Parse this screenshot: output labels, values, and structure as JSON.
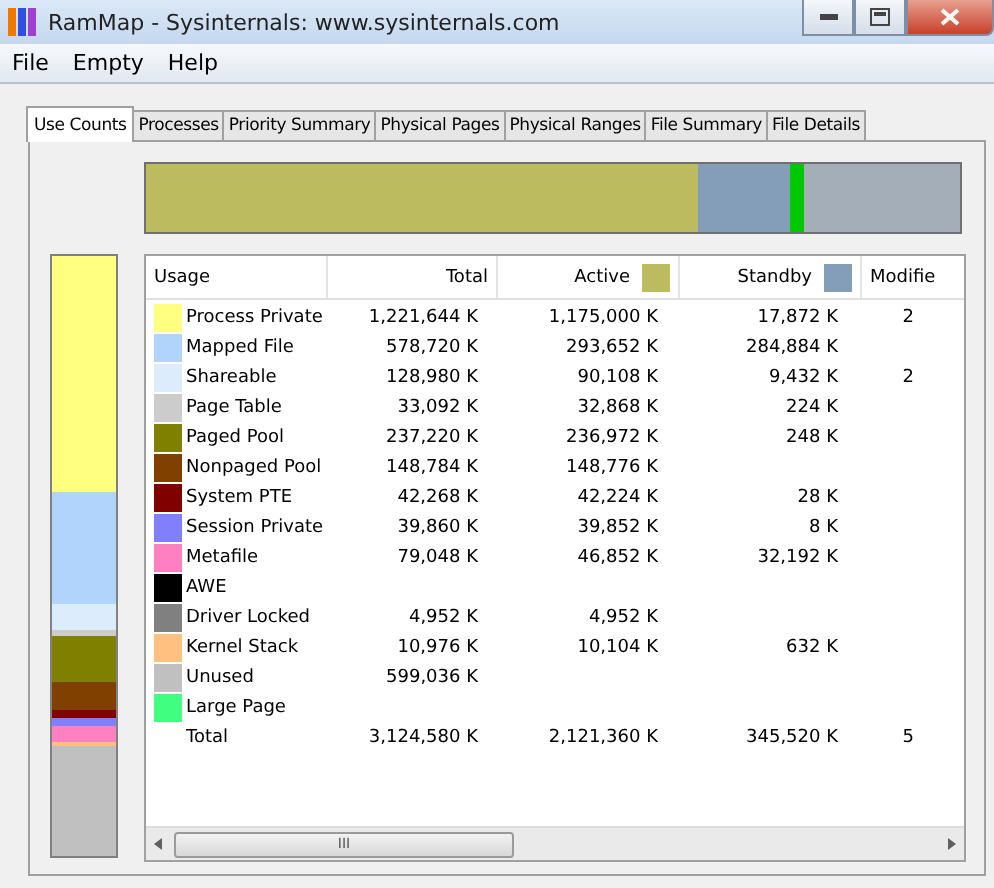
{
  "window": {
    "title": "RamMap - Sysinternals: www.sysinternals.com"
  },
  "menu": [
    "File",
    "Empty",
    "Help"
  ],
  "tabs": [
    {
      "label": "Use Counts",
      "selected": true
    },
    {
      "label": "Processes",
      "selected": false
    },
    {
      "label": "Priority Summary",
      "selected": false
    },
    {
      "label": "Physical Pages",
      "selected": false
    },
    {
      "label": "Physical Ranges",
      "selected": false
    },
    {
      "label": "File Summary",
      "selected": false
    },
    {
      "label": "File Details",
      "selected": false
    }
  ],
  "table": {
    "columns": [
      {
        "label": "Usage"
      },
      {
        "label": "Total"
      },
      {
        "label": "Active",
        "color": "#bdbb5f"
      },
      {
        "label": "Standby",
        "color": "#849eba"
      },
      {
        "label": "Modifie"
      }
    ],
    "rows": [
      {
        "color": "#ffff80",
        "usage": "Process Private",
        "total": "1,221,644 K",
        "active": "1,175,000 K",
        "standby": "17,872 K",
        "modified": "2"
      },
      {
        "color": "#b0d4fc",
        "usage": "Mapped File",
        "total": "578,720 K",
        "active": "293,652 K",
        "standby": "284,884 K",
        "modified": ""
      },
      {
        "color": "#dcecfc",
        "usage": "Shareable",
        "total": "128,980 K",
        "active": "90,108 K",
        "standby": "9,432 K",
        "modified": "2"
      },
      {
        "color": "#cccccc",
        "usage": "Page Table",
        "total": "33,092 K",
        "active": "32,868 K",
        "standby": "224 K",
        "modified": ""
      },
      {
        "color": "#808000",
        "usage": "Paged Pool",
        "total": "237,220 K",
        "active": "236,972 K",
        "standby": "248 K",
        "modified": ""
      },
      {
        "color": "#804000",
        "usage": "Nonpaged Pool",
        "total": "148,784 K",
        "active": "148,776 K",
        "standby": "",
        "modified": ""
      },
      {
        "color": "#800000",
        "usage": "System PTE",
        "total": "42,268 K",
        "active": "42,224 K",
        "standby": "28 K",
        "modified": ""
      },
      {
        "color": "#8080ff",
        "usage": "Session Private",
        "total": "39,860 K",
        "active": "39,852 K",
        "standby": "8 K",
        "modified": ""
      },
      {
        "color": "#ff80c0",
        "usage": "Metafile",
        "total": "79,048 K",
        "active": "46,852 K",
        "standby": "32,192 K",
        "modified": ""
      },
      {
        "color": "#000000",
        "usage": "AWE",
        "total": "",
        "active": "",
        "standby": "",
        "modified": ""
      },
      {
        "color": "#808080",
        "usage": "Driver Locked",
        "total": "4,952 K",
        "active": "4,952 K",
        "standby": "",
        "modified": ""
      },
      {
        "color": "#ffc080",
        "usage": "Kernel Stack",
        "total": "10,976 K",
        "active": "10,104 K",
        "standby": "632 K",
        "modified": ""
      },
      {
        "color": "#c0c0c0",
        "usage": "Unused",
        "total": "599,036 K",
        "active": "",
        "standby": "",
        "modified": ""
      },
      {
        "color": "#40ff80",
        "usage": "Large Page",
        "total": "",
        "active": "",
        "standby": "",
        "modified": ""
      }
    ],
    "total_row": {
      "usage": "Total",
      "total": "3,124,580 K",
      "active": "2,121,360 K",
      "standby": "345,520 K",
      "modified": "5"
    }
  },
  "scrollbar": {
    "thumb": "III"
  }
}
